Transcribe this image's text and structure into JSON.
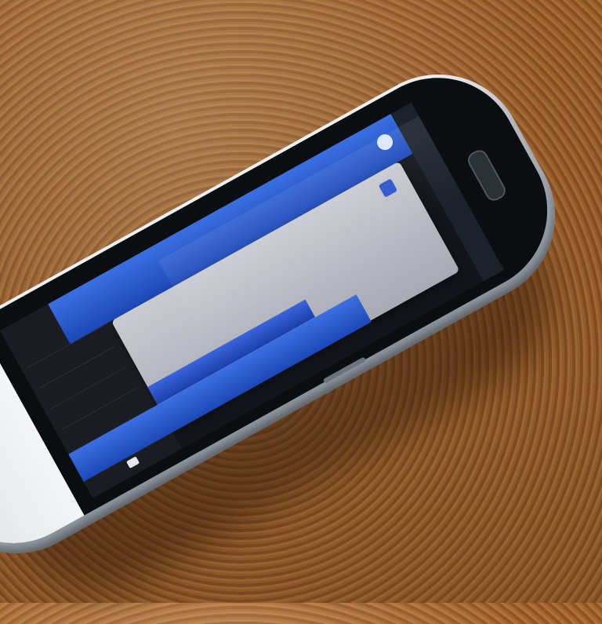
{
  "scene": {
    "surface_color": "#9a5c2b",
    "accent_blue": "#2d58c9"
  },
  "screen": {
    "header": {
      "title": ""
    },
    "dialog": {
      "title": "",
      "strip_text": "",
      "field_text": ""
    },
    "list": {
      "items": [
        "",
        "",
        "",
        ""
      ]
    },
    "bottom_button": {
      "label": ""
    }
  },
  "icons": {
    "header_icon": "account-icon",
    "dialog_icon": "app-icon",
    "nav_icon": "back-icon"
  }
}
